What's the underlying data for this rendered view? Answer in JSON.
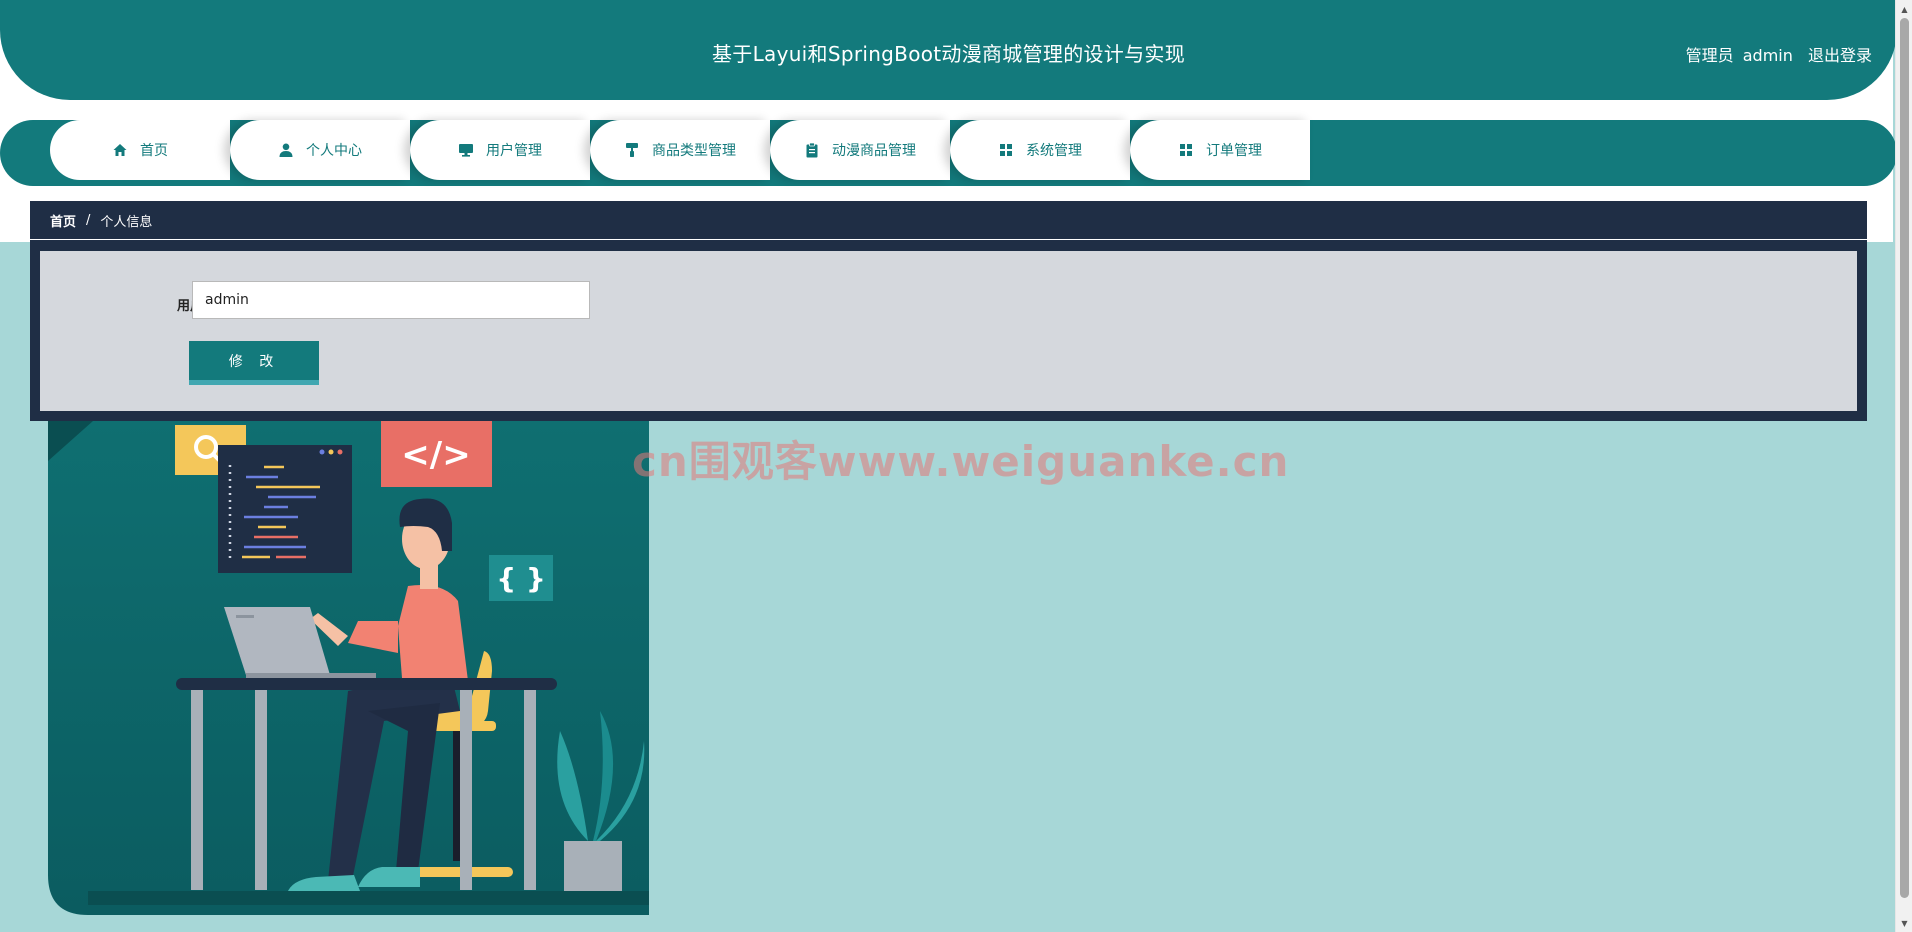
{
  "header": {
    "title": "基于Layui和SpringBoot动漫商城管理的设计与实现",
    "role": "管理员",
    "username": "admin",
    "logout": "退出登录"
  },
  "nav": [
    {
      "label": "首页",
      "icon": "home-icon"
    },
    {
      "label": "个人中心",
      "icon": "user-icon"
    },
    {
      "label": "用户管理",
      "icon": "monitor-icon"
    },
    {
      "label": "商品类型管理",
      "icon": "paint-roller-icon"
    },
    {
      "label": "动漫商品管理",
      "icon": "clipboard-icon"
    },
    {
      "label": "系统管理",
      "icon": "grid-icon"
    },
    {
      "label": "订单管理",
      "icon": "grid-icon"
    }
  ],
  "breadcrumb": {
    "home": "首页",
    "separator": "/",
    "current": "个人信息"
  },
  "form": {
    "username_label": "用户名",
    "username_value": "admin",
    "submit_label": "修 改"
  },
  "illustration": {
    "code_tag": "</>",
    "braces": "{ }"
  },
  "watermark": "cn围观客www.weiguanke.cn",
  "colors": {
    "primary": "#137a7c",
    "dark": "#1f2e45",
    "background": "#a7d7d7"
  }
}
